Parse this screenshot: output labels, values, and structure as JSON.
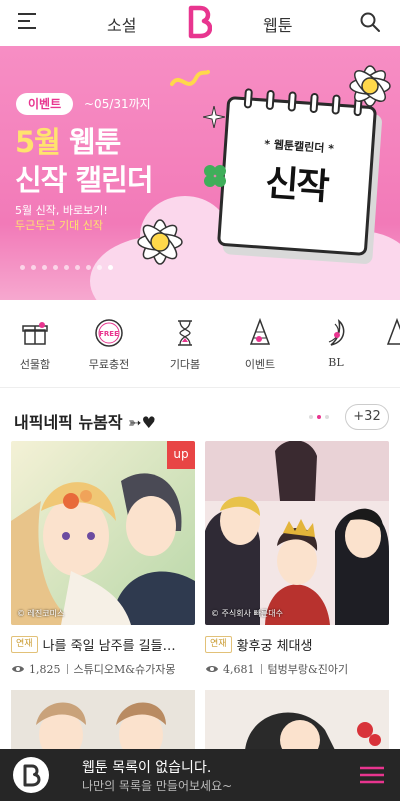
{
  "header": {
    "tab_novel": "소설",
    "tab_webtoon": "웹툰",
    "accent_color": "#e8358f"
  },
  "banner": {
    "badge": "이벤트",
    "period": "~05/31까지",
    "title_line1_highlight": "5월",
    "title_line1_rest": " 웹툰",
    "title_line2": "신작 캘린더",
    "subtitle1": "5월 신작, 바로보기!",
    "subtitle2": "두근두근 기대 신작",
    "calendar_label": "* 웹툰캘린더 *",
    "calendar_big": "신작",
    "slide_count": 9,
    "active_slide": 9
  },
  "categories": [
    {
      "label": "선물함",
      "icon": "gift-icon"
    },
    {
      "label": "무료충전",
      "icon": "free-coin-icon"
    },
    {
      "label": "기다봄",
      "icon": "hourglass-icon"
    },
    {
      "label": "이벤트",
      "icon": "party-hat-icon"
    },
    {
      "label": "BL",
      "icon": "banana-icon"
    }
  ],
  "section": {
    "title": "내픽네픽 뉴봄작 ➳♥",
    "more": "+32"
  },
  "cards": [
    {
      "badge": "up",
      "tag": "연재",
      "title": "나를 죽일 남주를 길들…",
      "views": "1,825",
      "author": "스튜디오M&슈가자몽",
      "watermark": "© 레진코미스"
    },
    {
      "tag": "연재",
      "title": "황후궁 체대생",
      "views": "4,681",
      "author": "텀벙부랑&진아기",
      "watermark": "© 주식회사 빠른대수"
    }
  ],
  "bottom_bar": {
    "line1": "웹툰 목록이 없습니다.",
    "line2": "나만의 목록을 만들어보세요~"
  }
}
